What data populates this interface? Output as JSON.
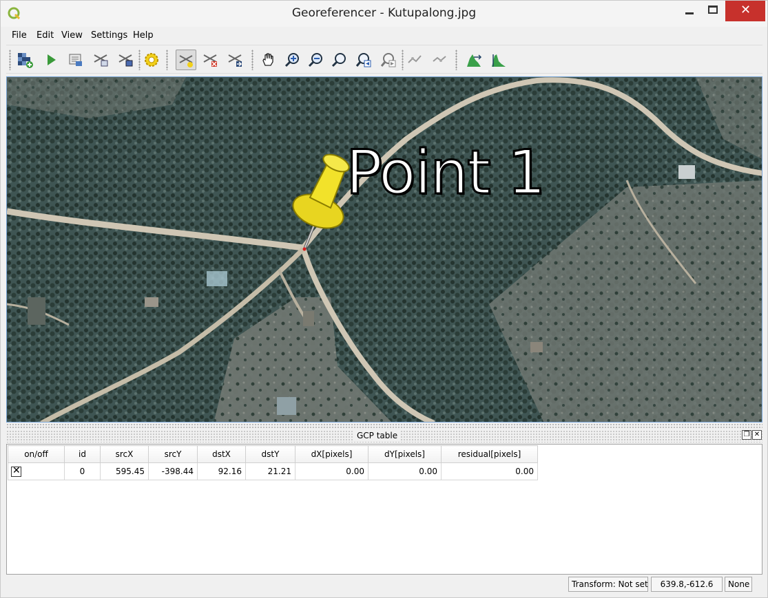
{
  "window": {
    "title": "Georeferencer - Kutupalong.jpg"
  },
  "menu": {
    "items": [
      "File",
      "Edit",
      "View",
      "Settings",
      "Help"
    ]
  },
  "toolbar": {
    "icons": [
      "add-raster-icon",
      "start-georeferencing-icon",
      "generate-gdal-script-icon",
      "load-gcp-points-icon",
      "save-gcp-points-icon",
      "transformation-settings-icon",
      "add-point-icon",
      "delete-point-icon",
      "move-gcp-point-icon",
      "pan-icon",
      "zoom-in-icon",
      "zoom-out-icon",
      "zoom-to-layer-icon",
      "zoom-last-icon",
      "zoom-next-icon",
      "link-georeferencer-to-qgis-icon",
      "link-qgis-to-georeferencer-icon",
      "full-histogram-stretch-icon",
      "local-histogram-stretch-icon"
    ],
    "active": "add-point-icon"
  },
  "canvas": {
    "point_label": "Point 1"
  },
  "gcp": {
    "title": "GCP table",
    "columns": [
      "on/off",
      "id",
      "srcX",
      "srcY",
      "dstX",
      "dstY",
      "dX[pixels]",
      "dY[pixels]",
      "residual[pixels]"
    ],
    "rows": [
      {
        "enabled": true,
        "id": "0",
        "srcX": "595.45",
        "srcY": "-398.44",
        "dstX": "92.16",
        "dstY": "21.21",
        "dX": "0.00",
        "dY": "0.00",
        "residual": "0.00"
      }
    ]
  },
  "status": {
    "transform": "Transform: Not set",
    "coords": "639.8,-612.6",
    "crs": "None"
  },
  "colors": {
    "accent": "#c7312c",
    "pin": "#f2e22a",
    "canvas_border": "#7ba7d9"
  }
}
